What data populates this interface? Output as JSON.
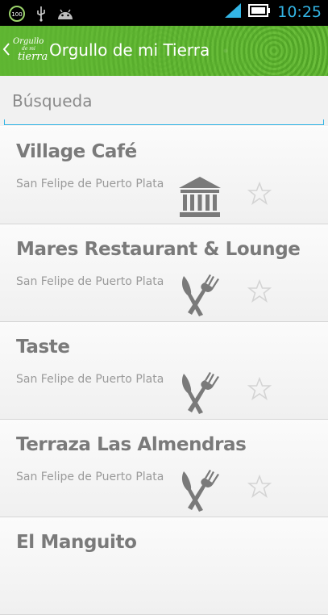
{
  "statusbar": {
    "battery_badge": "100",
    "time": "10:25",
    "icons": [
      "battery-full-icon",
      "usb-icon",
      "android-icon",
      "signal-icon",
      "battery-icon"
    ]
  },
  "actionbar": {
    "logo_text": [
      "Orgullo",
      "de mi",
      "tierra"
    ],
    "title": "Orgullo de mi Tierra",
    "brand_color": "#5fb632"
  },
  "search": {
    "placeholder": "Búsqueda",
    "value": ""
  },
  "list": {
    "items": [
      {
        "name": "Village Café",
        "location": "San Felipe de Puerto Plata",
        "category_icon": "museum-icon",
        "favorite": false
      },
      {
        "name": "Mares Restaurant & Lounge",
        "location": "San Felipe de Puerto Plata",
        "category_icon": "restaurant-icon",
        "favorite": false
      },
      {
        "name": "Taste",
        "location": "San Felipe de Puerto Plata",
        "category_icon": "restaurant-icon",
        "favorite": false
      },
      {
        "name": "Terraza Las Almendras",
        "location": "San Felipe de Puerto Plata",
        "category_icon": "restaurant-icon",
        "favorite": false
      },
      {
        "name": "El Manguito",
        "location": "",
        "category_icon": "",
        "favorite": false
      }
    ]
  }
}
